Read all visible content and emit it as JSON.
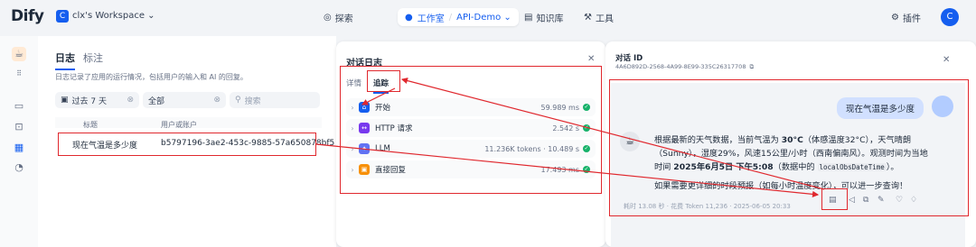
{
  "topbar": {
    "logo": "Dify",
    "workspace_badge": "C",
    "workspace_name": "clx's Workspace ⌄",
    "nav_explore": "探索",
    "nav_studio": "工作室",
    "breadcrumb_app": "API-Demo ⌄",
    "nav_knowledge": "知识库",
    "nav_tools": "工具",
    "plugins": "插件",
    "avatar_letter": "C"
  },
  "logs": {
    "tab_logs": "日志",
    "tab_annotations": "标注",
    "description": "日志记录了应用的运行情况，包括用户的输入和 AI 的回复。",
    "filter_period": "过去 7 天",
    "filter_status": "全部",
    "search_placeholder": "搜索",
    "col_title": "标题",
    "col_user": "用户或账户",
    "row_title": "现在气温是多少度",
    "row_user": "b5797196-3ae2-453c-9885-57a650878bf5"
  },
  "conversation_log": {
    "title": "对话日志",
    "tab_detail": "详情",
    "tab_tracing": "追踪",
    "nodes": [
      {
        "name": "开始",
        "meta": "59.989 ms",
        "color": "#155eef",
        "icon": "home-icon"
      },
      {
        "name": "HTTP 请求",
        "meta": "2.542 s",
        "color": "#7839ee",
        "icon": "http-icon"
      },
      {
        "name": "LLM",
        "meta": "11.236K tokens · 10.489 s",
        "color": "#6172f3",
        "icon": "llm-icon"
      },
      {
        "name": "直接回复",
        "meta": "17.493 ms",
        "color": "#f79009",
        "icon": "reply-icon"
      }
    ]
  },
  "detail": {
    "title": "对话 ID",
    "conversation_id": "4A6D892D-2568-4A99-8E99-335C26317708",
    "question": "现在气温是多少度",
    "answer_p1a": "根据最新的天气数据，当前气温为 ",
    "answer_temp": "30°C",
    "answer_p1b": "（体感温度32°C），天气晴朗（Sunny），湿度29%，风速15公里/小时（西南偏南风）。观测时间为当地时间 ",
    "answer_time": "2025年6月5日 下午5:08",
    "answer_p1c": "（数据中的 ",
    "answer_code": "localObsDateTime",
    "answer_p1d": "）。",
    "answer_p2": "如果需要更详细的时段预报（如每小时温度变化），可以进一步查询！",
    "meta": "耗时 13.08 秒 · 花费 Token 11,236 · 2025-06-05 20:33"
  },
  "colors": {
    "accent": "#155eef",
    "annotation_red": "#e0282e",
    "success": "#17b26a"
  }
}
